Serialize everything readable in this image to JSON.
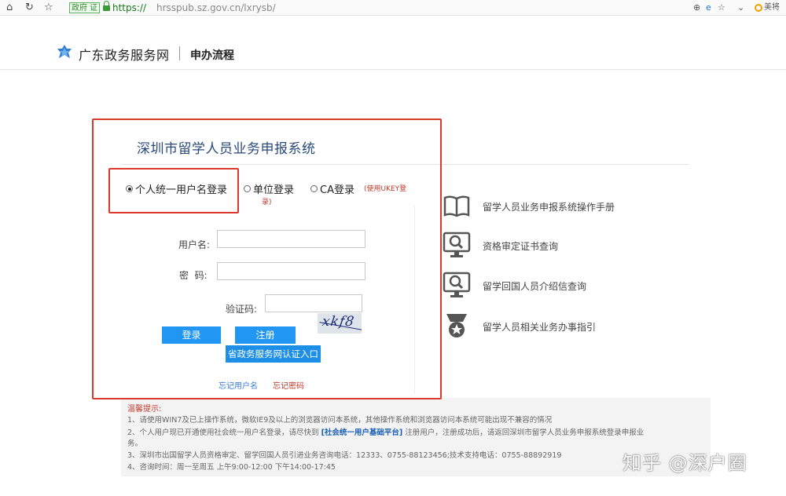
{
  "browser": {
    "gov_badge": "政府 证",
    "url_scheme": "https://",
    "url_host": "hrsspub.sz.gov.cn/lxrysb/",
    "extension_label": "美将"
  },
  "header": {
    "site_name": "广东政务服务网",
    "nav_title": "申办流程"
  },
  "panel": {
    "title": "深圳市留学人员业务申报系统"
  },
  "login_tabs": [
    {
      "label": "个人统一用户名登录",
      "checked": true
    },
    {
      "label": "单位登录",
      "checked": false
    },
    {
      "label": "CA登录",
      "checked": false
    }
  ],
  "ukey_note_part1": "(使用UKEY登",
  "ukey_note_part2": "录)",
  "form": {
    "username_label": "用户名:",
    "password_label": "密  码:",
    "captcha_label": "验证码:",
    "captcha_text": "xkf8",
    "login_button": "登录",
    "register_button": "注册",
    "provincial_button": "省政务服务网认证入口",
    "forgot_username": "忘记用户名",
    "forgot_password": "忘记密码"
  },
  "side_links": [
    {
      "label": "留学人员业务申报系统操作手册",
      "icon": "book-icon"
    },
    {
      "label": "资格审定证书查询",
      "icon": "monitor-search-icon"
    },
    {
      "label": "留学回国人员介绍信查询",
      "icon": "monitor-search-icon"
    },
    {
      "label": "留学人员相关业务办事指引",
      "icon": "medal-icon"
    }
  ],
  "notice": {
    "title": "温馨提示:",
    "line1": "1、请使用WIN7及已上操作系统，微软IE9及以上的浏览器访问本系统，其他操作系统和浏览器访问本系统可能出现不兼容的情况",
    "line2_pre": "2、个人用户现已开通使用社会统一用户名登录，请尽快到 ",
    "line2_link": "[社会统一用户基础平台]",
    "line2_post": " 注册用户，注册成功后，请返回深圳市留学人员业务申报系统登录申报业",
    "line2_cont": "务。",
    "line3": "3、深圳市出国留学人员资格审定、留学回国人员引进业务咨询电话：12333、0755-88123456;技术支持电话：0755-88892919",
    "line4": "4、咨询时间：周一至周五 上午9:00-12:00 下午14:00-17:45"
  },
  "watermark": "知乎 @深户圈",
  "colors": {
    "accent_blue": "#2196f3",
    "title_blue": "#2a4a7a",
    "annotation_red": "#d93a2b",
    "warning_red": "#c0392b"
  }
}
